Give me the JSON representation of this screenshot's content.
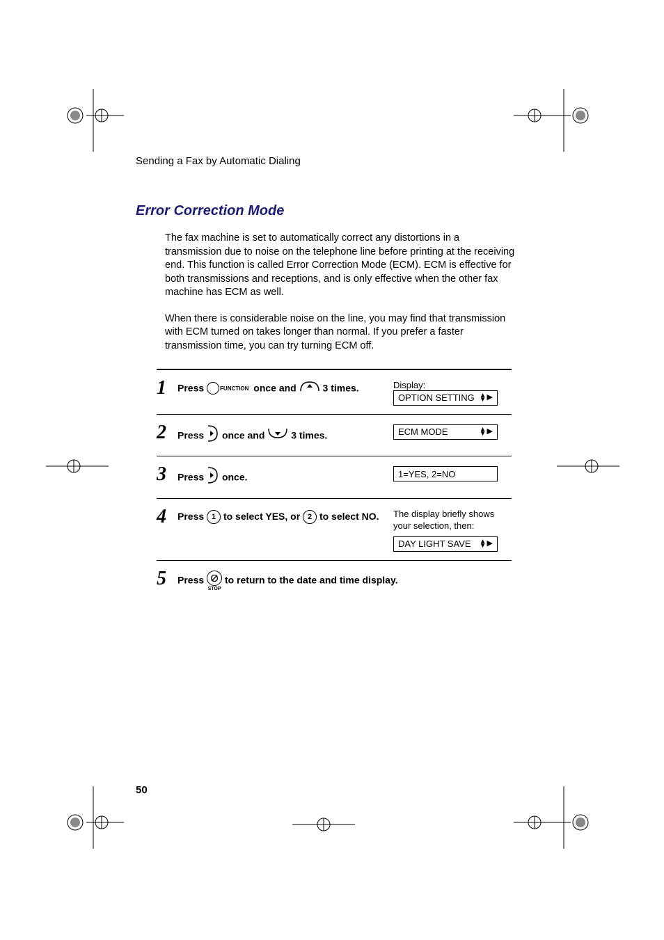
{
  "header": {
    "breadcrumb": "Sending a Fax by Automatic Dialing"
  },
  "section": {
    "title": "Error Correction Mode"
  },
  "paragraphs": {
    "p1": "The fax machine is set to automatically correct any distortions in a transmission due to noise on the telephone line before printing at the receiving end. This function is called Error Correction Mode (ECM). ECM is effective for both transmissions and receptions, and is only effective when the other fax machine has ECM as well.",
    "p2": "When there is considerable noise on the line, you may find that transmission with ECM turned on takes longer than normal. If you prefer a faster transmission time, you can try turning ECM off."
  },
  "labels": {
    "function": "FUNCTION",
    "stop": "STOP",
    "display": "Display:"
  },
  "steps": {
    "s1": {
      "num": "1",
      "press": "Press",
      "mid": " once and ",
      "end": " 3 times.",
      "lcd": "OPTION SETTING"
    },
    "s2": {
      "num": "2",
      "press": "Press",
      "mid": " once and ",
      "end": " 3 times.",
      "lcd": "ECM MODE"
    },
    "s3": {
      "num": "3",
      "press": "Press",
      "end": " once.",
      "lcd": "1=YES, 2=NO"
    },
    "s4": {
      "num": "4",
      "press": "Press",
      "mid": " to select YES, or ",
      "end": " to select NO.",
      "btn1": "1",
      "btn2": "2",
      "note": "The display briefly shows your selection, then:",
      "lcd": "DAY LIGHT SAVE"
    },
    "s5": {
      "num": "5",
      "press": "Press",
      "end": " to return to the date and time display."
    }
  },
  "page_number": "50"
}
